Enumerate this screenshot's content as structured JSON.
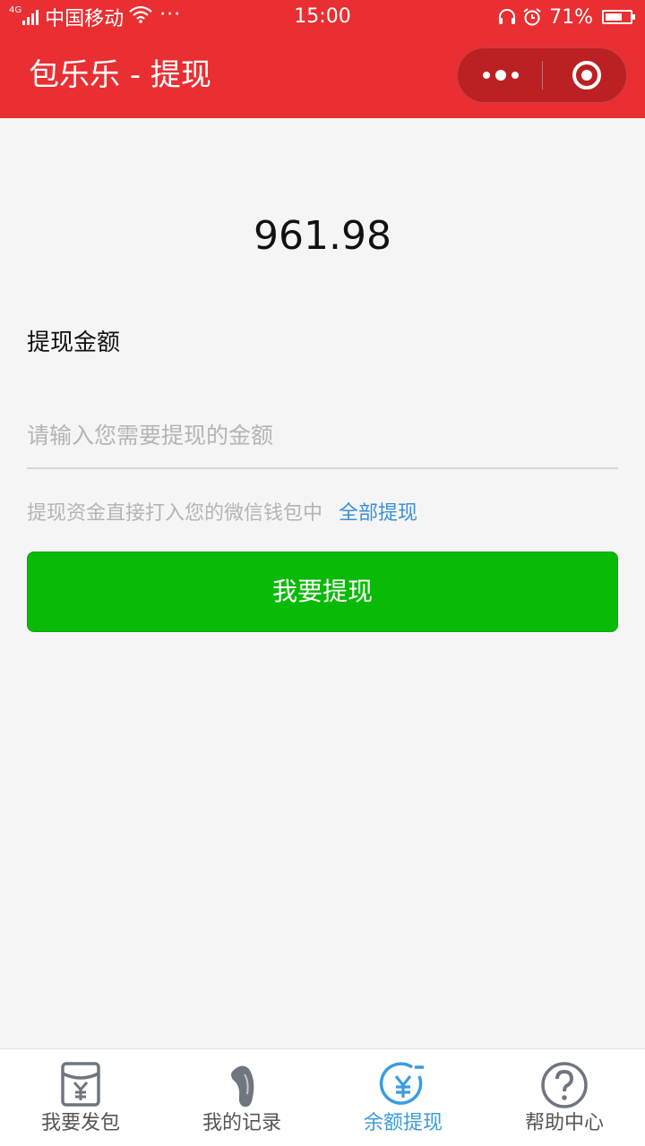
{
  "status_bar": {
    "network": "4G",
    "carrier": "中国移动",
    "more": "···",
    "time": "15:00",
    "battery_pct": "71%",
    "battery_level": 0.71,
    "icons": [
      "signal-icon",
      "wifi-icon",
      "headset-icon",
      "alarm-icon",
      "battery-icon"
    ]
  },
  "nav": {
    "title": "包乐乐 - 提现",
    "color": "#e92f32",
    "capsule_icons": [
      "more-dots-icon",
      "close-circle-icon"
    ]
  },
  "main": {
    "balance": "961.98",
    "amount_label": "提现金额",
    "amount_input": {
      "value": "",
      "placeholder": "请输入您需要提现的金额"
    },
    "hint": "提现资金直接打入您的微信钱包中",
    "withdraw_all": "全部提现",
    "submit_label": "我要提现",
    "submit_color": "#09bb07",
    "link_color": "#3c8fd8"
  },
  "tabbar": {
    "active_color": "#3c9be0",
    "items": [
      {
        "label": "我要发包",
        "icon": "red-packet-icon",
        "active": false
      },
      {
        "label": "我的记录",
        "icon": "record-icon",
        "active": false
      },
      {
        "label": "余额提现",
        "icon": "yuan-withdraw-icon",
        "active": true
      },
      {
        "label": "帮助中心",
        "icon": "help-icon",
        "active": false
      }
    ]
  }
}
